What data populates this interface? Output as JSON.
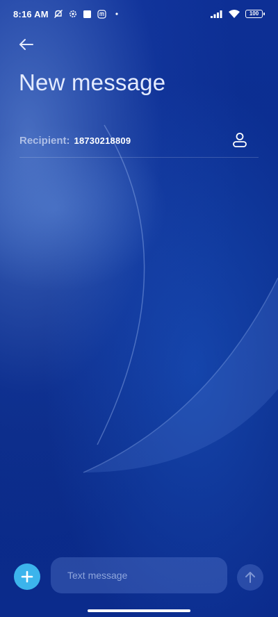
{
  "status_bar": {
    "time": "8:16 AM",
    "icons_left": [
      "notifications-off-icon",
      "settings-gear-icon",
      "square-notification-icon",
      "mi-icon",
      "dot-icon"
    ],
    "icons_right": [
      "signal-icon",
      "wifi-icon",
      "battery-icon"
    ],
    "battery_level": "100"
  },
  "header": {
    "back_icon": "arrow-left-icon",
    "title": "New message"
  },
  "recipient": {
    "label": "Recipient:",
    "value": "18730218809",
    "contact_icon": "person-icon"
  },
  "compose": {
    "add_icon": "plus-icon",
    "placeholder": "Text message",
    "value": "",
    "send_icon": "arrow-up-icon"
  },
  "colors": {
    "background": "#0b2b8c",
    "accent": "#3cb4ec",
    "title_text": "#e4ebff",
    "label_text": "#aebfe6"
  }
}
